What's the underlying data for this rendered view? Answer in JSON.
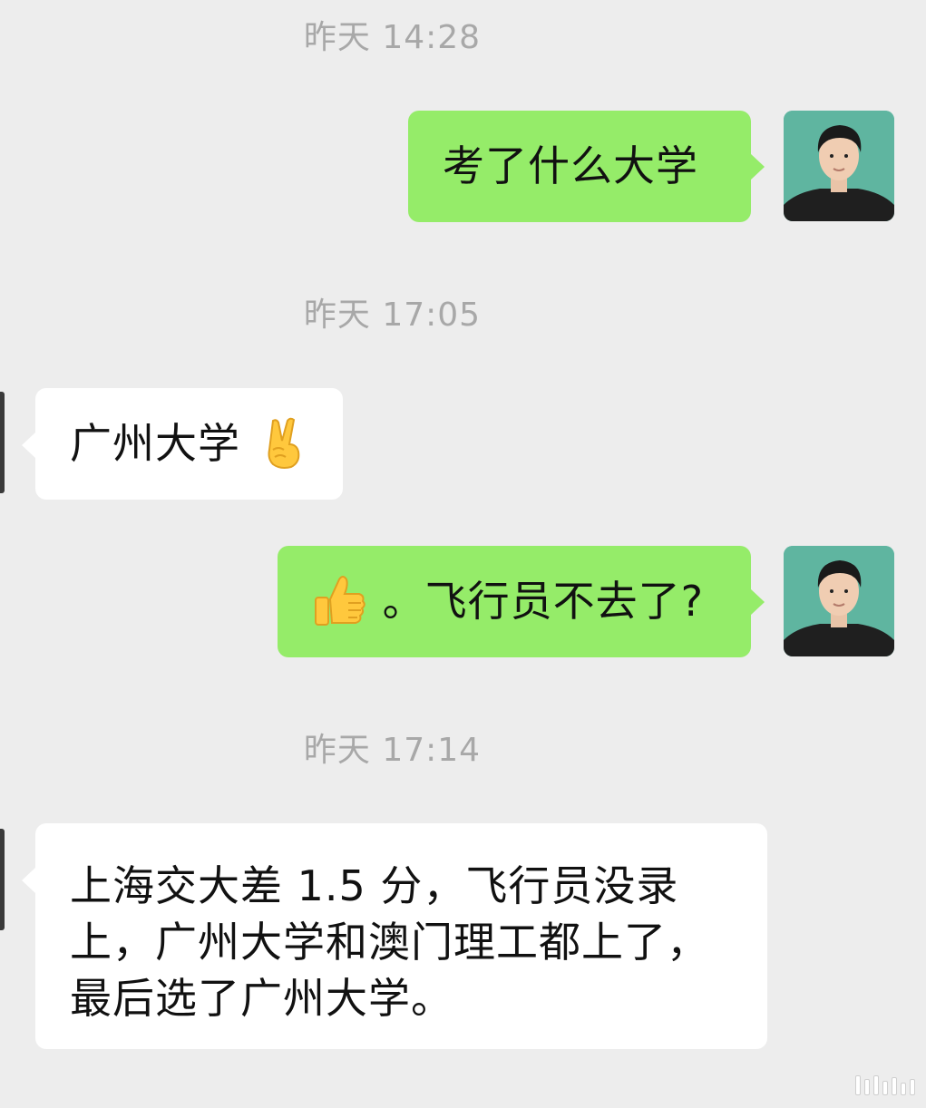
{
  "messages": [
    {
      "type": "timestamp",
      "text": "昨天 14:28"
    },
    {
      "type": "sent",
      "text": "考了什么大学"
    },
    {
      "type": "timestamp",
      "text": "昨天 17:05"
    },
    {
      "type": "received",
      "text": "广州大学",
      "emoji": "victory-hand-emoji"
    },
    {
      "type": "sent",
      "emoji": "thumbs-up-emoji",
      "text": "。飞行员不去了?"
    },
    {
      "type": "timestamp",
      "text": "昨天 17:14"
    },
    {
      "type": "received",
      "lines": [
        "上海交大差 1.5 分，飞行员没录",
        "上，广州大学和澳门理工都上了，",
        "最后选了广州大学。"
      ]
    }
  ],
  "colors": {
    "background": "#ededed",
    "sent_bubble": "#95ec69",
    "received_bubble": "#ffffff",
    "timestamp": "#a8a8a8",
    "avatar_background": "#5fb5a0"
  },
  "icons": {
    "avatar": "user-portrait-avatar",
    "watermark": "bar-watermark"
  }
}
